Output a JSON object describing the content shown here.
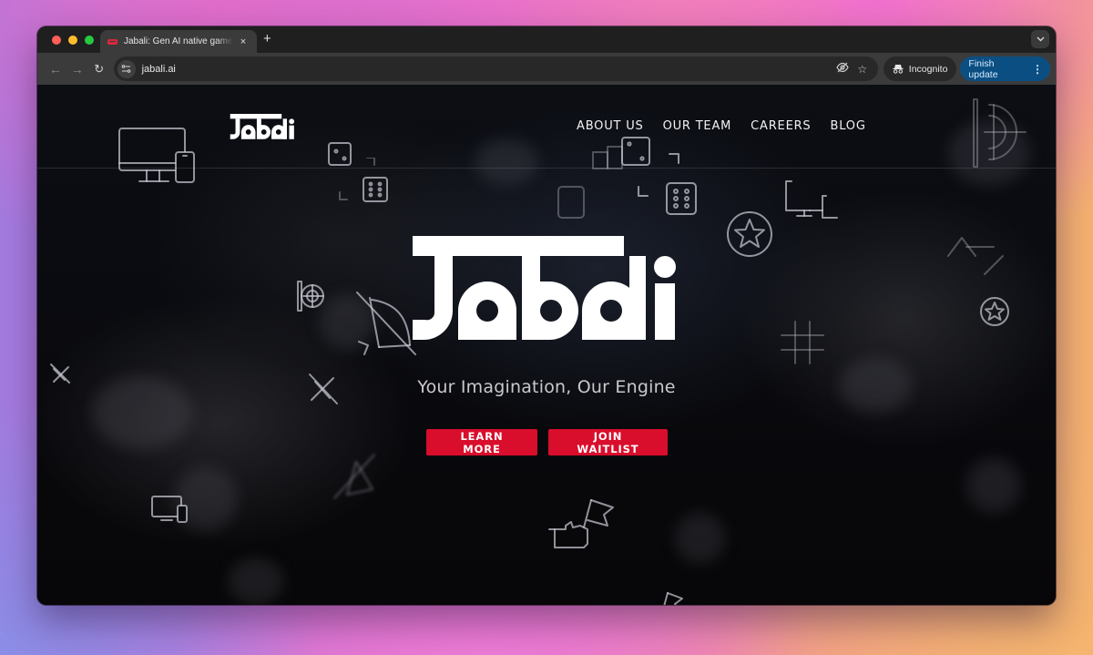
{
  "browser": {
    "tab": {
      "title": "Jabali: Gen AI native game engine",
      "favicon": "jabali-favicon",
      "close_icon": "×"
    },
    "new_tab_icon": "+",
    "tab_menu_icon": "⌄",
    "toolbar": {
      "back_icon": "←",
      "forward_icon": "→",
      "reload_icon": "↻",
      "site_info_icon": "⚙",
      "url": "jabali.ai",
      "eye_off_icon": "⊘",
      "bookmark_icon": "☆",
      "incognito_label": "Incognito",
      "incognito_icon": "🕶",
      "finish_update_label": "Finish update",
      "menu_icon": "⋮"
    }
  },
  "site": {
    "logo_text": "Jabali",
    "nav": [
      {
        "label": "ABOUT US"
      },
      {
        "label": "OUR TEAM"
      },
      {
        "label": "CAREERS"
      },
      {
        "label": "BLOG"
      }
    ],
    "hero": {
      "logo_text": "Jabali",
      "tagline": "Your Imagination, Our Engine",
      "buttons": [
        {
          "label": "LEARN MORE"
        },
        {
          "label": "JOIN WAITLIST"
        }
      ]
    },
    "colors": {
      "accent": "#d90d2c",
      "background": "#0a0b10",
      "logo": "#ffffff"
    }
  }
}
